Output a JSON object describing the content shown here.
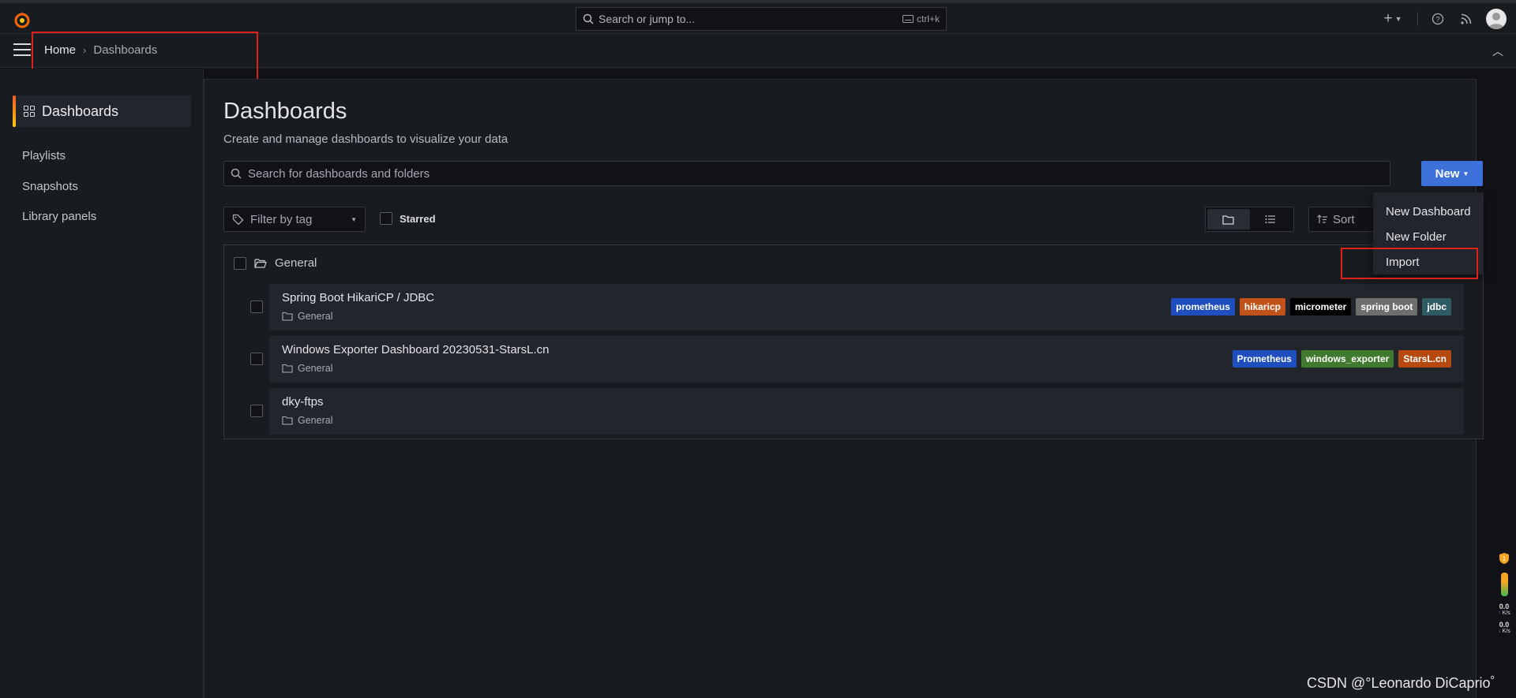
{
  "topbar": {
    "search_placeholder": "Search or jump to...",
    "shortcut": "ctrl+k"
  },
  "breadcrumb": {
    "home": "Home",
    "separator": "›",
    "current": "Dashboards"
  },
  "sidebar": {
    "active": "Dashboards",
    "items": [
      {
        "label": "Playlists"
      },
      {
        "label": "Snapshots"
      },
      {
        "label": "Library panels"
      }
    ]
  },
  "page": {
    "title": "Dashboards",
    "subtitle": "Create and manage dashboards to visualize your data",
    "search_placeholder": "Search for dashboards and folders",
    "new_label": "New",
    "filter_tag_placeholder": "Filter by tag",
    "starred_label": "Starred",
    "sort_label": "Sort"
  },
  "new_menu": {
    "items": [
      "New Dashboard",
      "New Folder",
      "Import"
    ]
  },
  "folder": {
    "name": "General"
  },
  "dashboards": [
    {
      "title": "Spring Boot HikariCP / JDBC",
      "location": "General",
      "tags": [
        {
          "label": "prometheus",
          "color": "#1f4fbf"
        },
        {
          "label": "hikaricp",
          "color": "#c1531a"
        },
        {
          "label": "micrometer",
          "color": "#000000"
        },
        {
          "label": "spring boot",
          "color": "#6e6e6e"
        },
        {
          "label": "jdbc",
          "color": "#2d5a63"
        }
      ]
    },
    {
      "title": "Windows Exporter Dashboard 20230531-StarsL.cn",
      "location": "General",
      "tags": [
        {
          "label": "Prometheus",
          "color": "#1f4fbf"
        },
        {
          "label": "windows_exporter",
          "color": "#3f7a2e"
        },
        {
          "label": "StarsL.cn",
          "color": "#b5490f"
        }
      ]
    },
    {
      "title": "dky-ftps",
      "location": "General",
      "tags": []
    }
  ],
  "widget": {
    "badge": "1",
    "up": "0.0",
    "up_unit": "K/s",
    "down": "0.0",
    "down_unit": "K/s"
  },
  "watermark": "CSDN @°Leonardo DiCaprio゜"
}
